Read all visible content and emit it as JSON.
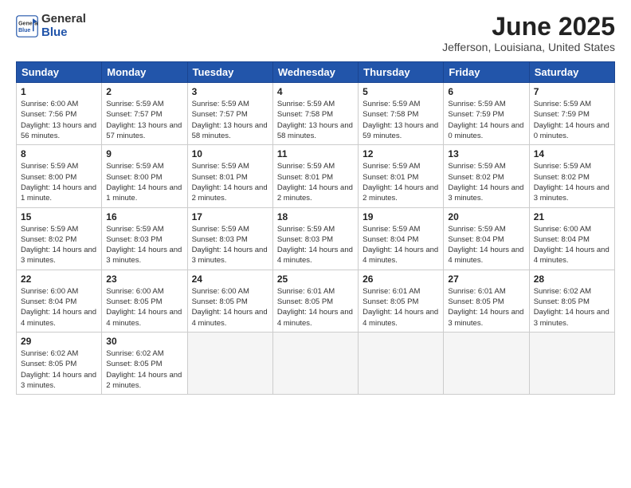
{
  "logo": {
    "line1": "General",
    "line2": "Blue"
  },
  "title": "June 2025",
  "subtitle": "Jefferson, Louisiana, United States",
  "weekdays": [
    "Sunday",
    "Monday",
    "Tuesday",
    "Wednesday",
    "Thursday",
    "Friday",
    "Saturday"
  ],
  "weeks": [
    [
      {
        "day": "1",
        "sunrise": "Sunrise: 6:00 AM",
        "sunset": "Sunset: 7:56 PM",
        "daylight": "Daylight: 13 hours and 56 minutes."
      },
      {
        "day": "2",
        "sunrise": "Sunrise: 5:59 AM",
        "sunset": "Sunset: 7:57 PM",
        "daylight": "Daylight: 13 hours and 57 minutes."
      },
      {
        "day": "3",
        "sunrise": "Sunrise: 5:59 AM",
        "sunset": "Sunset: 7:57 PM",
        "daylight": "Daylight: 13 hours and 58 minutes."
      },
      {
        "day": "4",
        "sunrise": "Sunrise: 5:59 AM",
        "sunset": "Sunset: 7:58 PM",
        "daylight": "Daylight: 13 hours and 58 minutes."
      },
      {
        "day": "5",
        "sunrise": "Sunrise: 5:59 AM",
        "sunset": "Sunset: 7:58 PM",
        "daylight": "Daylight: 13 hours and 59 minutes."
      },
      {
        "day": "6",
        "sunrise": "Sunrise: 5:59 AM",
        "sunset": "Sunset: 7:59 PM",
        "daylight": "Daylight: 14 hours and 0 minutes."
      },
      {
        "day": "7",
        "sunrise": "Sunrise: 5:59 AM",
        "sunset": "Sunset: 7:59 PM",
        "daylight": "Daylight: 14 hours and 0 minutes."
      }
    ],
    [
      {
        "day": "8",
        "sunrise": "Sunrise: 5:59 AM",
        "sunset": "Sunset: 8:00 PM",
        "daylight": "Daylight: 14 hours and 1 minute."
      },
      {
        "day": "9",
        "sunrise": "Sunrise: 5:59 AM",
        "sunset": "Sunset: 8:00 PM",
        "daylight": "Daylight: 14 hours and 1 minute."
      },
      {
        "day": "10",
        "sunrise": "Sunrise: 5:59 AM",
        "sunset": "Sunset: 8:01 PM",
        "daylight": "Daylight: 14 hours and 2 minutes."
      },
      {
        "day": "11",
        "sunrise": "Sunrise: 5:59 AM",
        "sunset": "Sunset: 8:01 PM",
        "daylight": "Daylight: 14 hours and 2 minutes."
      },
      {
        "day": "12",
        "sunrise": "Sunrise: 5:59 AM",
        "sunset": "Sunset: 8:01 PM",
        "daylight": "Daylight: 14 hours and 2 minutes."
      },
      {
        "day": "13",
        "sunrise": "Sunrise: 5:59 AM",
        "sunset": "Sunset: 8:02 PM",
        "daylight": "Daylight: 14 hours and 3 minutes."
      },
      {
        "day": "14",
        "sunrise": "Sunrise: 5:59 AM",
        "sunset": "Sunset: 8:02 PM",
        "daylight": "Daylight: 14 hours and 3 minutes."
      }
    ],
    [
      {
        "day": "15",
        "sunrise": "Sunrise: 5:59 AM",
        "sunset": "Sunset: 8:02 PM",
        "daylight": "Daylight: 14 hours and 3 minutes."
      },
      {
        "day": "16",
        "sunrise": "Sunrise: 5:59 AM",
        "sunset": "Sunset: 8:03 PM",
        "daylight": "Daylight: 14 hours and 3 minutes."
      },
      {
        "day": "17",
        "sunrise": "Sunrise: 5:59 AM",
        "sunset": "Sunset: 8:03 PM",
        "daylight": "Daylight: 14 hours and 3 minutes."
      },
      {
        "day": "18",
        "sunrise": "Sunrise: 5:59 AM",
        "sunset": "Sunset: 8:03 PM",
        "daylight": "Daylight: 14 hours and 4 minutes."
      },
      {
        "day": "19",
        "sunrise": "Sunrise: 5:59 AM",
        "sunset": "Sunset: 8:04 PM",
        "daylight": "Daylight: 14 hours and 4 minutes."
      },
      {
        "day": "20",
        "sunrise": "Sunrise: 5:59 AM",
        "sunset": "Sunset: 8:04 PM",
        "daylight": "Daylight: 14 hours and 4 minutes."
      },
      {
        "day": "21",
        "sunrise": "Sunrise: 6:00 AM",
        "sunset": "Sunset: 8:04 PM",
        "daylight": "Daylight: 14 hours and 4 minutes."
      }
    ],
    [
      {
        "day": "22",
        "sunrise": "Sunrise: 6:00 AM",
        "sunset": "Sunset: 8:04 PM",
        "daylight": "Daylight: 14 hours and 4 minutes."
      },
      {
        "day": "23",
        "sunrise": "Sunrise: 6:00 AM",
        "sunset": "Sunset: 8:05 PM",
        "daylight": "Daylight: 14 hours and 4 minutes."
      },
      {
        "day": "24",
        "sunrise": "Sunrise: 6:00 AM",
        "sunset": "Sunset: 8:05 PM",
        "daylight": "Daylight: 14 hours and 4 minutes."
      },
      {
        "day": "25",
        "sunrise": "Sunrise: 6:01 AM",
        "sunset": "Sunset: 8:05 PM",
        "daylight": "Daylight: 14 hours and 4 minutes."
      },
      {
        "day": "26",
        "sunrise": "Sunrise: 6:01 AM",
        "sunset": "Sunset: 8:05 PM",
        "daylight": "Daylight: 14 hours and 4 minutes."
      },
      {
        "day": "27",
        "sunrise": "Sunrise: 6:01 AM",
        "sunset": "Sunset: 8:05 PM",
        "daylight": "Daylight: 14 hours and 3 minutes."
      },
      {
        "day": "28",
        "sunrise": "Sunrise: 6:02 AM",
        "sunset": "Sunset: 8:05 PM",
        "daylight": "Daylight: 14 hours and 3 minutes."
      }
    ],
    [
      {
        "day": "29",
        "sunrise": "Sunrise: 6:02 AM",
        "sunset": "Sunset: 8:05 PM",
        "daylight": "Daylight: 14 hours and 3 minutes."
      },
      {
        "day": "30",
        "sunrise": "Sunrise: 6:02 AM",
        "sunset": "Sunset: 8:05 PM",
        "daylight": "Daylight: 14 hours and 2 minutes."
      },
      null,
      null,
      null,
      null,
      null
    ]
  ]
}
